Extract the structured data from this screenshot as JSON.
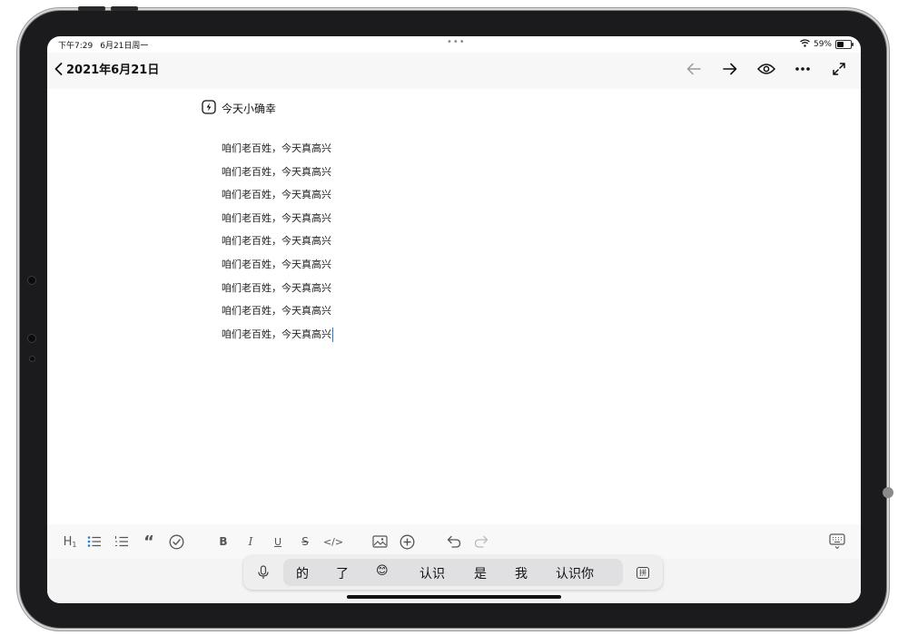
{
  "status_bar": {
    "time": "下午7:29",
    "date": "6月21日周一",
    "center_dots": "•••",
    "battery_percent": "59%",
    "battery_level": 0.59
  },
  "nav": {
    "back_title": "2021年6月21日",
    "icons": [
      "back-arrow-icon",
      "forward-arrow-icon",
      "eye-icon",
      "more-icon",
      "fullscreen-icon"
    ]
  },
  "note": {
    "title": "今天小确幸",
    "title_icon": "lightning-icon",
    "lines": [
      "咱们老百姓，今天真高兴",
      "咱们老百姓，今天真高兴",
      "咱们老百姓，今天真高兴",
      "咱们老百姓，今天真高兴",
      "咱们老百姓，今天真高兴",
      "咱们老百姓，今天真高兴",
      "咱们老百姓，今天真高兴",
      "咱们老百姓，今天真高兴",
      "咱们老百姓，今天真高兴"
    ]
  },
  "toolbar": {
    "heading_label": "H",
    "heading_sub": "1",
    "bold_label": "B",
    "italic_label": "I",
    "underline_label": "U",
    "strike_label": "S",
    "code_label": "</>",
    "quote_label": "“"
  },
  "ime": {
    "candidates": [
      "的",
      "了",
      "😊",
      "认识",
      "是",
      "我",
      "认识你"
    ],
    "switch_label": "拼"
  },
  "colors": {
    "accent": "#1a7be0",
    "frame": "#1b1b1d"
  }
}
